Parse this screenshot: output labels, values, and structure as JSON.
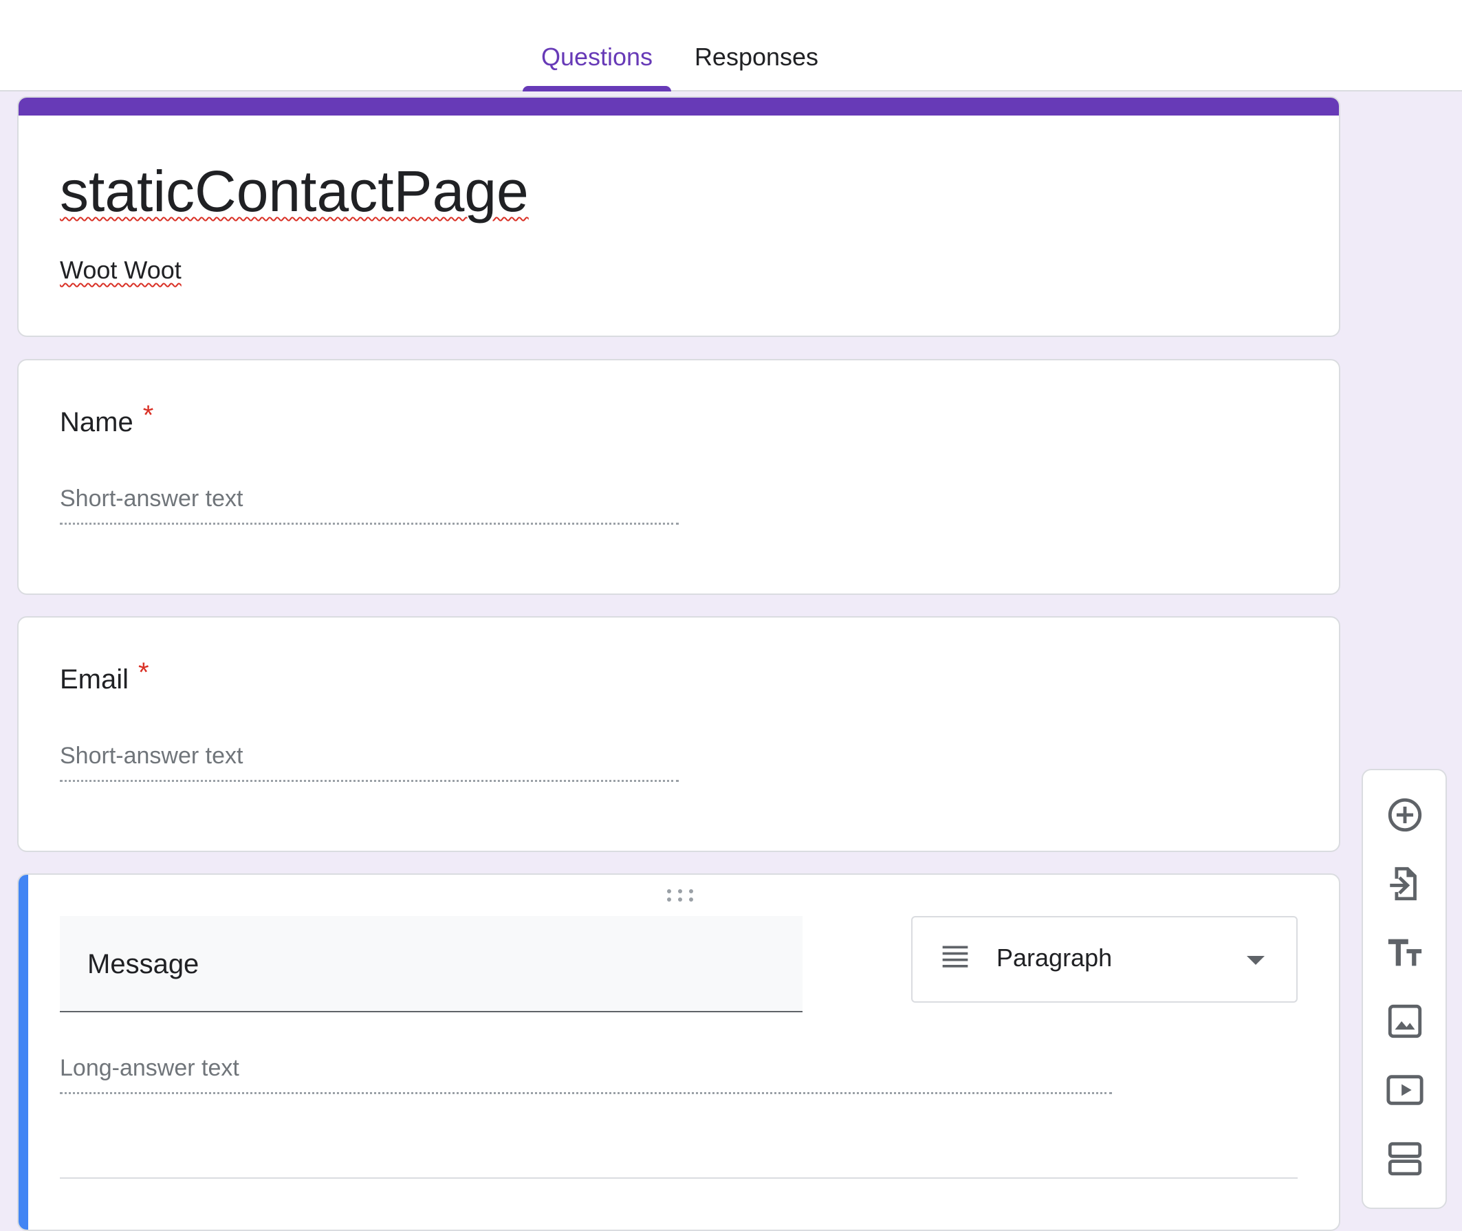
{
  "tabs": [
    {
      "label": "Questions",
      "active": true
    },
    {
      "label": "Responses",
      "active": false
    }
  ],
  "form": {
    "title": "staticContactPage",
    "description": "Woot Woot"
  },
  "questions": [
    {
      "title": "Name",
      "required_mark": "*",
      "answer_hint": "Short-answer text"
    },
    {
      "title": "Email",
      "required_mark": "*",
      "answer_hint": "Short-answer text"
    },
    {
      "title": "Message",
      "type_label": "Paragraph",
      "answer_hint": "Long-answer text"
    }
  ],
  "toolbar": {
    "icons": [
      "add-question-icon",
      "import-questions-icon",
      "add-title-icon",
      "add-image-icon",
      "add-video-icon",
      "add-section-icon"
    ]
  },
  "colors": {
    "accent": "#673ab7",
    "active_question": "#4285f4",
    "background": "#f0ebf8",
    "required": "#d93025"
  }
}
